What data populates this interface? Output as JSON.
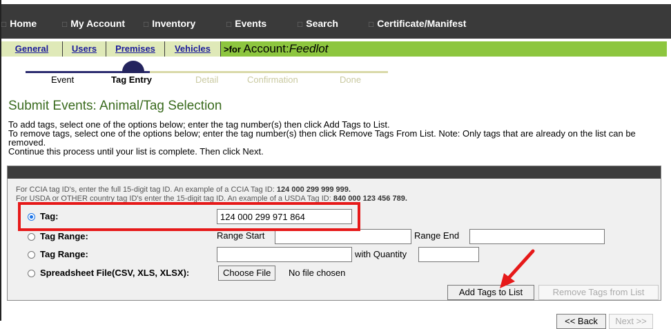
{
  "nav": {
    "items": [
      "Home",
      "My Account",
      "Inventory",
      "Events",
      "Search",
      "Certificate/Manifest"
    ]
  },
  "subnav": {
    "tabs": [
      "General",
      "Users",
      "Premises",
      "Vehicles"
    ],
    "for_label": ">for",
    "account_label": "Account:",
    "account_name": "Feedlot"
  },
  "progress": {
    "steps": [
      "Event",
      "Tag Entry",
      "Detail",
      "Confirmation",
      "Done"
    ],
    "active_index": 1
  },
  "page": {
    "title": "Submit Events: Animal/Tag Selection",
    "instructions": [
      "To add tags, select one of the options below; enter the tag number(s) then click Add Tags to List.",
      "To remove tags, select one of the options below; enter the tag number(s) then click Remove Tags From List. Note: Only tags that are already on the list can be removed.",
      "Continue this process until your list is complete. Then click Next."
    ]
  },
  "panel": {
    "hint1_text": "For CCIA tag ID's, enter the full 15-digit tag ID. An example of a CCIA Tag ID:",
    "hint1_example": "124 000 299 999 999.",
    "hint2_text": "For USDA or OTHER country tag ID's enter the 15-digit tag ID. An example of a USDA Tag ID:",
    "hint2_example": "840 000 123 456 789.",
    "tag_label": "Tag:",
    "tag_value": "124 000 299 971 864",
    "range_label": "Tag Range:",
    "range_start_label": "Range Start",
    "range_end_label": "Range End",
    "range_qty_label": "Tag Range:",
    "with_quantity_label": "with Quantity",
    "spreadsheet_label": "Spreadsheet File(CSV, XLS, XLSX):",
    "choose_file_label": "Choose File",
    "no_file_label": "No file chosen",
    "add_tags_label": "Add Tags to List",
    "remove_tags_label": "Remove Tags from List"
  },
  "footer": {
    "back_label": "<< Back",
    "next_label": "Next >>"
  },
  "colors": {
    "nav_bg": "#3a3a3a",
    "subnav_bg": "#8dc63f",
    "title_green": "#3a6b1e",
    "highlight_red": "#e61919"
  }
}
